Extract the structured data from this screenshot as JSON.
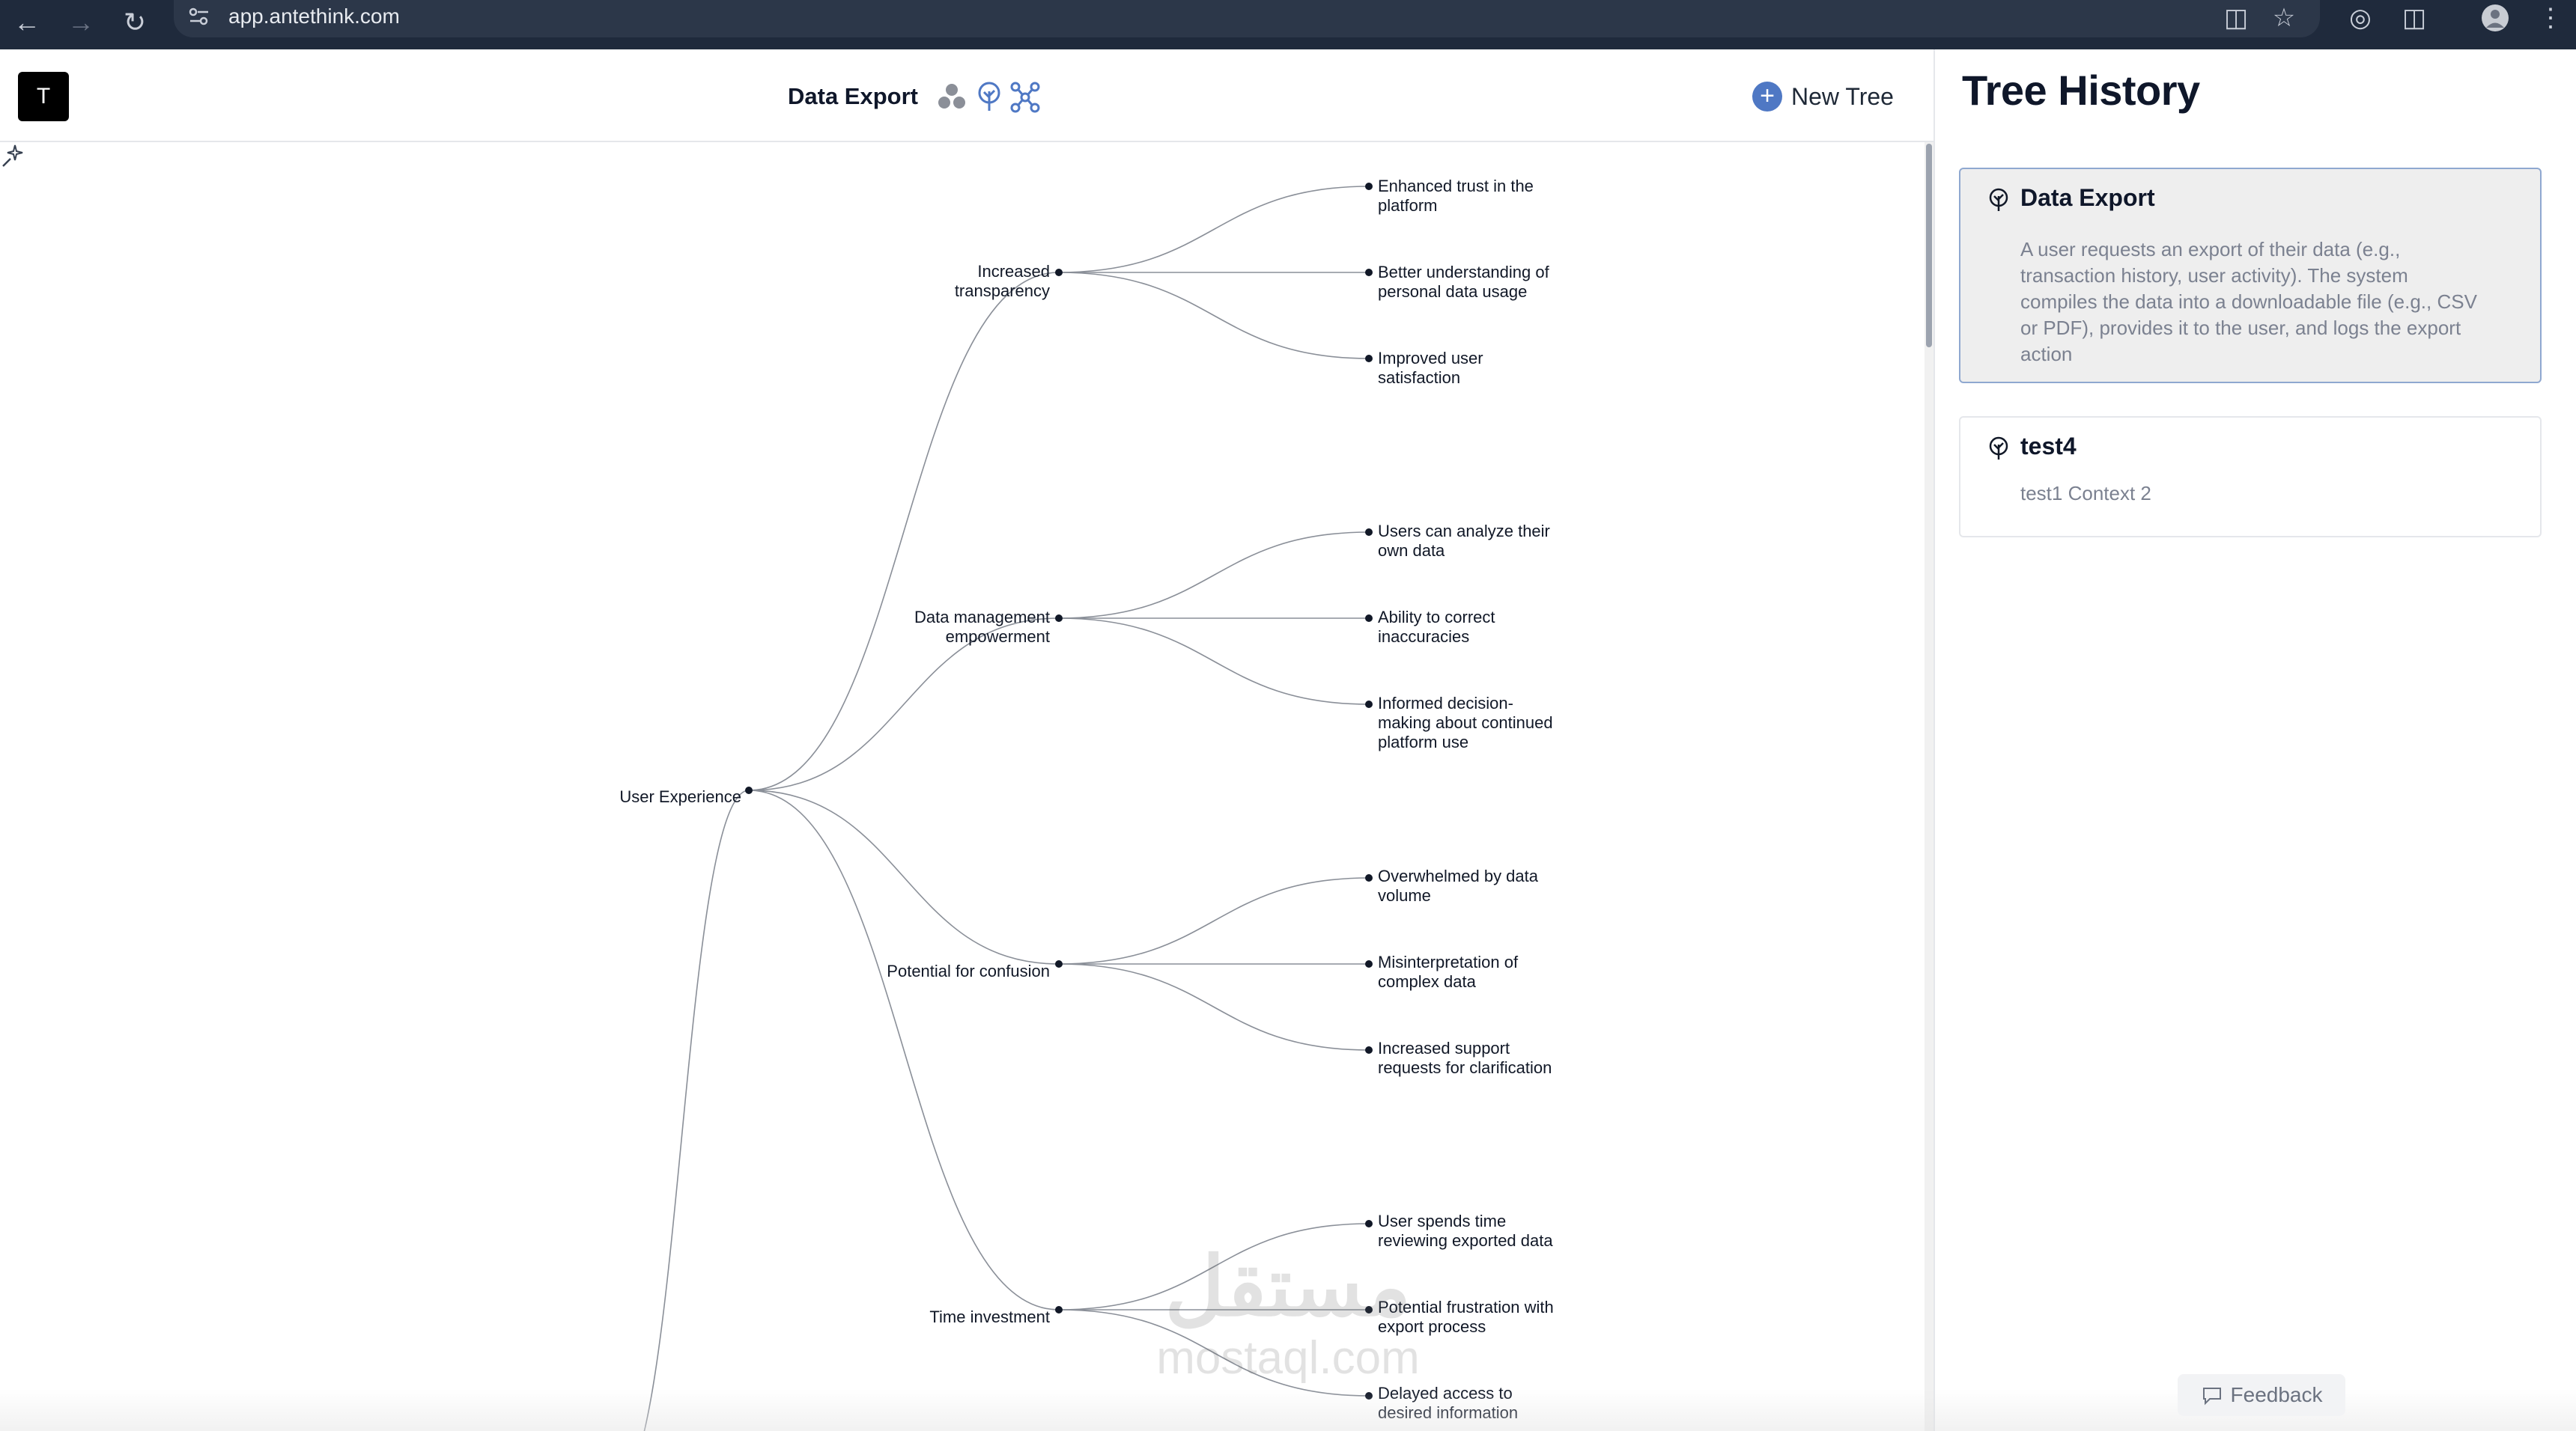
{
  "browser": {
    "url": "app.antethink.com",
    "icons": [
      "back-arrow-icon",
      "forward-arrow-icon",
      "reload-icon",
      "site-settings-icon",
      "install-app-icon",
      "star-icon",
      "extension-target-icon",
      "puzzle-icon",
      "profile-avatar",
      "more-vert-icon"
    ]
  },
  "header": {
    "logo_letter": "T",
    "title": "Data Export",
    "view_icons": [
      "bubbles-view-icon",
      "tree-view-icon",
      "network-view-icon"
    ],
    "new_tree_label": "New Tree"
  },
  "tree": {
    "root": "User Experience",
    "branches": [
      {
        "label": "Increased transparency",
        "leaves": [
          "Enhanced trust in the platform",
          "Better understanding of personal data usage",
          "Improved user satisfaction"
        ]
      },
      {
        "label": "Data management empowerment",
        "leaves": [
          "Users can analyze their own data",
          "Ability to correct inaccuracies",
          "Informed decision-making about continued platform use"
        ]
      },
      {
        "label": "Potential for confusion",
        "leaves": [
          "Overwhelmed by data volume",
          "Misinterpretation of complex data",
          "Increased support requests for clarification"
        ]
      },
      {
        "label": "Time investment",
        "leaves": [
          "User spends time reviewing exported data",
          "Potential frustration with export process",
          "Delayed access to desired information"
        ]
      }
    ]
  },
  "labels": {
    "root": "User Experience",
    "b0": "Increased\ntransparency",
    "b1": "Data management\nempowerment",
    "b2": "Potential for confusion",
    "b3": "Time investment",
    "b0l0": "Enhanced trust in the\nplatform",
    "b0l1": "Better understanding of\npersonal data usage",
    "b0l2": "Improved user\nsatisfaction",
    "b1l0": "Users can analyze their\nown data",
    "b1l1": "Ability to correct\ninaccuracies",
    "b1l2": "Informed decision-\nmaking about continued\nplatform use",
    "b2l0": "Overwhelmed by data\nvolume",
    "b2l1": "Misinterpretation of\ncomplex data",
    "b2l2": "Increased support\nrequests for clarification",
    "b3l0": "User spends time\nreviewing exported data",
    "b3l1": "Potential frustration with\nexport process",
    "b3l2": "Delayed access to\ndesired information"
  },
  "sidebar": {
    "title": "Tree History",
    "items": [
      {
        "title": "Data Export",
        "description": "A user requests an export of their data (e.g., transaction history, user activity). The system compiles the data into a downloadable file (e.g., CSV or PDF), provides it to the user, and logs the export action",
        "active": true
      },
      {
        "title": "test4",
        "description": "test1 Context 2",
        "active": false
      }
    ]
  },
  "watermark": {
    "arabic": "مستقل",
    "latin": "mostaql.com"
  },
  "feedback_label": "Feedback",
  "colors": {
    "accent": "#4f78c4",
    "chrome": "#1f2a3c",
    "active_card": "#eeeeee"
  }
}
